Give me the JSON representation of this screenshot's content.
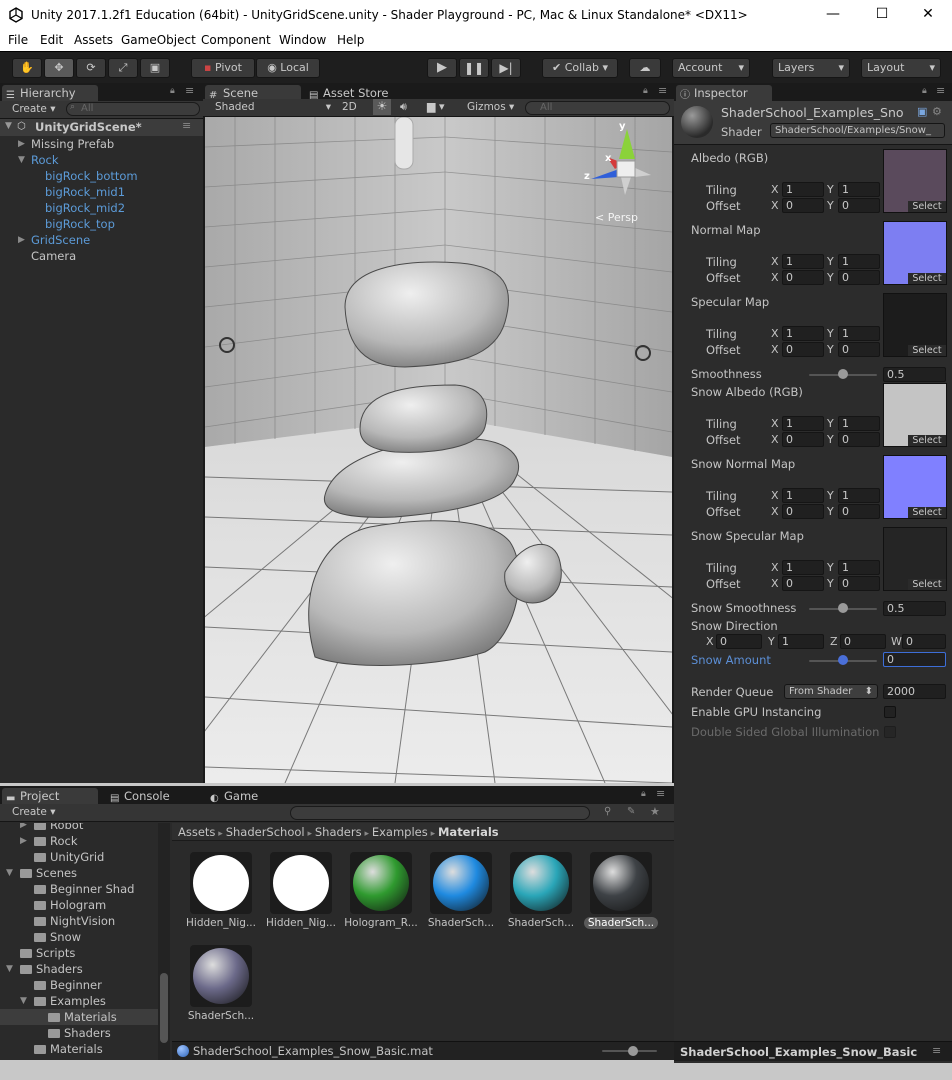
{
  "window": {
    "title": "Unity 2017.1.2f1 Education (64bit) - UnityGridScene.unity - Shader Playground - PC, Mac & Linux Standalone* <DX11>",
    "controls": [
      "—",
      "☐",
      "✕"
    ]
  },
  "menu": [
    "File",
    "Edit",
    "Assets",
    "GameObject",
    "Component",
    "Window",
    "Help"
  ],
  "toolbar": {
    "pivot": "Pivot",
    "local": "Local",
    "collab": "Collab",
    "account": "Account",
    "layers": "Layers",
    "layout": "Layout"
  },
  "hierarchy": {
    "tab": "Hierarchy",
    "create": "Create",
    "search_placeholder": "All",
    "scene": "UnityGridScene*",
    "items": [
      {
        "label": "Missing Prefab",
        "blue": false,
        "indent": 1,
        "arrow": "right"
      },
      {
        "label": "Rock",
        "blue": true,
        "indent": 1,
        "arrow": "down"
      },
      {
        "label": "bigRock_bottom",
        "blue": true,
        "indent": 2,
        "arrow": ""
      },
      {
        "label": "bigRock_mid1",
        "blue": true,
        "indent": 2,
        "arrow": ""
      },
      {
        "label": "bigRock_mid2",
        "blue": true,
        "indent": 2,
        "arrow": ""
      },
      {
        "label": "bigRock_top",
        "blue": true,
        "indent": 2,
        "arrow": ""
      },
      {
        "label": "GridScene",
        "blue": true,
        "indent": 1,
        "arrow": "right"
      },
      {
        "label": "Camera",
        "blue": false,
        "indent": 1,
        "arrow": ""
      }
    ]
  },
  "scene": {
    "tab_scene": "Scene",
    "tab_store": "Asset Store",
    "shaded": "Shaded",
    "mode_2d": "2D",
    "gizmos": "Gizmos",
    "search_placeholder": "All",
    "persp": "< Persp",
    "axis_y": "y",
    "axis_x": "x",
    "axis_z": "z"
  },
  "inspector": {
    "tab": "Inspector",
    "name": "ShaderSchool_Examples_Sno",
    "shader_label": "Shader",
    "shader_value": "ShaderSchool/Examples/Snow_",
    "select": "Select",
    "tiling": "Tiling",
    "offset": "Offset",
    "x": "X",
    "y": "Y",
    "z": "Z",
    "w": "W",
    "textures": [
      {
        "label": "Albedo (RGB)",
        "tx": "1",
        "ty": "1",
        "ox": "0",
        "oy": "0",
        "color": "#5a4a5c"
      },
      {
        "label": "Normal Map",
        "tx": "1",
        "ty": "1",
        "ox": "0",
        "oy": "0",
        "color": "#7d7ef2"
      },
      {
        "label": "Specular Map",
        "tx": "1",
        "ty": "1",
        "ox": "0",
        "oy": "0",
        "color": "#1c1c1c"
      },
      {
        "label": "Snow Albedo (RGB)",
        "tx": "1",
        "ty": "1",
        "ox": "0",
        "oy": "0",
        "color": "#c4c4c4"
      },
      {
        "label": "Snow Normal Map",
        "tx": "1",
        "ty": "1",
        "ox": "0",
        "oy": "0",
        "color": "#8080ff"
      },
      {
        "label": "Snow Specular Map",
        "tx": "1",
        "ty": "1",
        "ox": "0",
        "oy": "0",
        "color": "#252525"
      }
    ],
    "smoothness_label": "Smoothness",
    "smoothness_value": "0.5",
    "smoothness_fraction": 0.5,
    "snow_smoothness_label": "Snow Smoothness",
    "snow_smoothness_value": "0.5",
    "snow_smoothness_fraction": 0.5,
    "snow_direction_label": "Snow Direction",
    "snow_dir": {
      "x": "0",
      "y": "1",
      "z": "0",
      "w": "0"
    },
    "snow_amount_label": "Snow Amount",
    "snow_amount_value": "0",
    "snow_amount_fraction": 0.5,
    "render_queue_label": "Render Queue",
    "render_queue_mode": "From Shader",
    "render_queue_value": "2000",
    "gpu_instancing_label": "Enable GPU Instancing",
    "double_sided_label": "Double Sided Global Illumination",
    "footer": "ShaderSchool_Examples_Snow_Basic"
  },
  "project": {
    "tab_project": "Project",
    "tab_console": "Console",
    "tab_game": "Game",
    "create": "Create",
    "breadcrumb": [
      "Assets",
      "ShaderSchool",
      "Shaders",
      "Examples",
      "Materials"
    ],
    "tree": [
      {
        "label": "Robot",
        "indent": 3,
        "arrow": "right"
      },
      {
        "label": "Rock",
        "indent": 3,
        "arrow": "right"
      },
      {
        "label": "UnityGrid",
        "indent": 3,
        "arrow": ""
      },
      {
        "label": "Scenes",
        "indent": 2,
        "arrow": "down"
      },
      {
        "label": "Beginner Shad",
        "indent": 3,
        "arrow": ""
      },
      {
        "label": "Hologram",
        "indent": 3,
        "arrow": ""
      },
      {
        "label": "NightVision",
        "indent": 3,
        "arrow": ""
      },
      {
        "label": "Snow",
        "indent": 3,
        "arrow": ""
      },
      {
        "label": "Scripts",
        "indent": 2,
        "arrow": ""
      },
      {
        "label": "Shaders",
        "indent": 2,
        "arrow": "down"
      },
      {
        "label": "Beginner",
        "indent": 3,
        "arrow": ""
      },
      {
        "label": "Examples",
        "indent": 3,
        "arrow": "down"
      },
      {
        "label": "Materials",
        "indent": 4,
        "arrow": "",
        "selected": true
      },
      {
        "label": "Shaders",
        "indent": 4,
        "arrow": ""
      },
      {
        "label": "Materials",
        "indent": 3,
        "arrow": ""
      }
    ],
    "assets": [
      {
        "label": "Hidden_Nig...",
        "color": "#ffffff",
        "selected": false
      },
      {
        "label": "Hidden_Nig...",
        "color": "#ffffff",
        "selected": false
      },
      {
        "label": "Hologram_R...",
        "color": "#2f9a2f",
        "selected": false
      },
      {
        "label": "ShaderSch...",
        "color": "#1f8ae0",
        "selected": false
      },
      {
        "label": "ShaderSch...",
        "color": "#2aa6b8",
        "selected": false
      },
      {
        "label": "ShaderSch...",
        "color": "#3e4246",
        "selected": true
      },
      {
        "label": "ShaderSch...",
        "color": "#6c6a8a",
        "selected": false
      }
    ],
    "status": "ShaderSchool_Examples_Snow_Basic.mat"
  }
}
